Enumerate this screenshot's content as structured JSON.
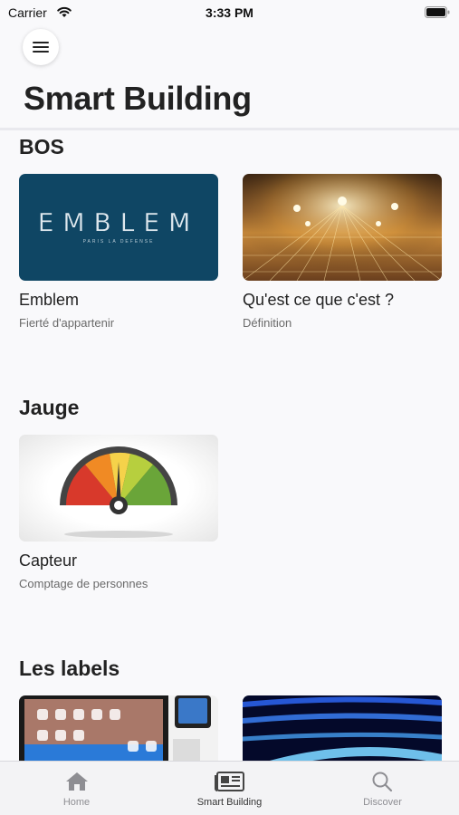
{
  "status_bar": {
    "carrier": "Carrier",
    "time": "3:33 PM"
  },
  "header": {
    "title": "Smart Building",
    "menu_icon": "hamburger-menu-icon"
  },
  "sections": [
    {
      "title": "BOS",
      "cards": [
        {
          "title": "Emblem",
          "subtitle": "Fierté d'appartenir",
          "image_text": "EMBLEM",
          "image_subtext": "PARIS LA DEFENSE"
        },
        {
          "title": "Qu'est ce que c'est ?",
          "subtitle": "Définition"
        }
      ]
    },
    {
      "title": "Jauge",
      "cards": [
        {
          "title": "Capteur",
          "subtitle": "Comptage de personnes"
        }
      ]
    },
    {
      "title": "Les labels",
      "cards": []
    }
  ],
  "tab_bar": {
    "tabs": [
      {
        "label": "Home",
        "icon": "home-icon",
        "active": false
      },
      {
        "label": "Smart Building",
        "icon": "newspaper-icon",
        "active": true
      },
      {
        "label": "Discover",
        "icon": "search-icon",
        "active": false
      }
    ]
  }
}
